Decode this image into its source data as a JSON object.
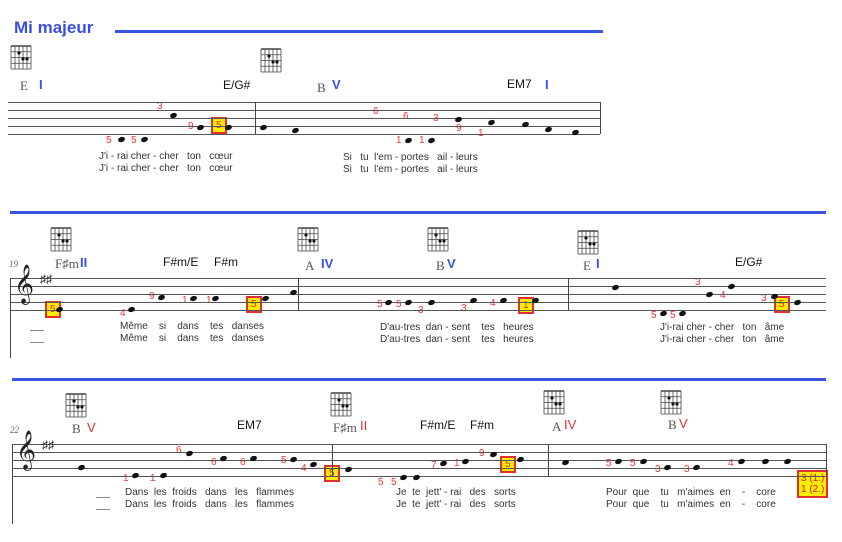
{
  "title": "Mi majeur",
  "colors": {
    "accent": "#3a56e0",
    "fingering": "#e33333",
    "highlight": "#ffee00"
  },
  "systems": [
    {
      "measure_number": "",
      "chords": [
        "E",
        "E/G#",
        "B",
        "EM7"
      ],
      "degrees": [
        "I",
        "V",
        "I"
      ],
      "fingerings": [
        "5",
        "5",
        "3",
        "9",
        "9",
        "1",
        "1",
        "6",
        "6",
        "3",
        "9",
        "1"
      ],
      "highlighted": [
        "5"
      ],
      "lyrics": [
        {
          "verse1": "J'i - rai cher - cher   ton   cœur",
          "verse2": "J'i - rai cher - cher   ton   cœur"
        },
        {
          "verse1": "Si   tu  l'em - portes   ail - leurs",
          "verse2": "Si   tu  l'em - portes   ail - leurs"
        }
      ]
    },
    {
      "measure_number": "19",
      "chords": [
        "F♯m",
        "F#m/E",
        "F#m",
        "A",
        "B",
        "E",
        "E/G#"
      ],
      "degrees": [
        "II",
        "IV",
        "V",
        "I"
      ],
      "fingerings": [
        "4",
        "9",
        "1",
        "1",
        "5",
        "5",
        "3",
        "3",
        "4",
        "5",
        "5",
        "3",
        "4",
        "3"
      ],
      "highlighted": [
        "5",
        "5",
        "1",
        "5"
      ],
      "lyrics": [
        {
          "verse1": "Même    si    dans    tes   danses",
          "verse2": "Même    si    dans    tes   danses"
        },
        {
          "verse1": "D'au-tres  dan - sent    tes   heures",
          "verse2": "D'au-tres  dan - sent    tes   heures"
        },
        {
          "verse1": "J'i-rai cher - cher   ton   âme",
          "verse2": "J'i-rai cher - cher   ton   âme"
        }
      ]
    },
    {
      "measure_number": "22",
      "chords": [
        "B",
        "EM7",
        "F♯m",
        "F#m/E",
        "F#m",
        "A",
        "B"
      ],
      "degrees": [
        "V",
        "II",
        "IV",
        "V"
      ],
      "fingerings": [
        "1",
        "1",
        "6",
        "6",
        "6",
        "5",
        "4",
        "5",
        "5",
        "7",
        "1",
        "9",
        "5",
        "5",
        "3",
        "3",
        "4"
      ],
      "highlighted": [
        "5",
        "5"
      ],
      "final_box": [
        "3 (1.)",
        "1 (2.)"
      ],
      "lyrics": [
        {
          "verse1": "Dans  les  froids   dans   les   flammes",
          "verse2": "Dans  les  froids   dans   les   flammes"
        },
        {
          "verse1": "Je  te  jett' - rai   des   sorts",
          "verse2": "Je  te  jett' - rai   des   sorts"
        },
        {
          "verse1": "Pour  que    tu   m'aimes  en    -    core",
          "verse2": "Pour  que    tu   m'aimes  en    -    core"
        }
      ]
    }
  ]
}
